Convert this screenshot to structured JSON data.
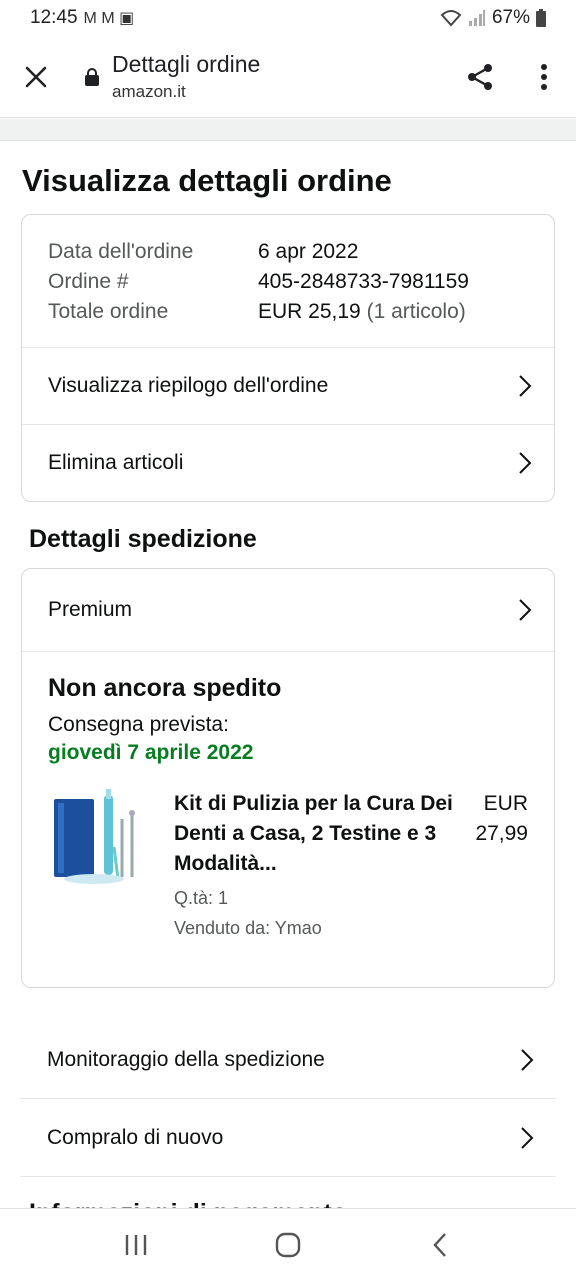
{
  "status_bar": {
    "time": "12:45",
    "notif_icons": "M M ▣",
    "battery": "67%"
  },
  "browser": {
    "title": "Dettagli ordine",
    "domain": "amazon.it"
  },
  "page": {
    "title": "Visualizza dettagli ordine"
  },
  "order": {
    "date_label": "Data dell'ordine",
    "date_value": "6 apr 2022",
    "number_label": "Ordine #",
    "number_value": "405-2848733-7981159",
    "total_label": "Totale ordine",
    "total_value": "EUR 25,19",
    "total_count": "(1 articolo)",
    "summary_link": "Visualizza riepilogo dell'ordine",
    "delete_link": "Elimina articoli"
  },
  "shipping": {
    "section_title": "Dettagli spedizione",
    "method": "Premium",
    "status": "Non ancora spedito",
    "delivery_label": "Consegna prevista:",
    "delivery_date": "giovedì 7 aprile 2022",
    "product": {
      "title": "Kit di Pulizia per la Cura Dei Denti a Casa, 2 Testine e 3 Modalità...",
      "qty": "Q.tà: 1",
      "seller": "Venduto da: Ymao",
      "currency": "EUR",
      "price": "27,99"
    },
    "tracking_link": "Monitoraggio della spedizione",
    "buy_again_link": "Compralo di nuovo"
  },
  "next_section_partial": "Informazioni di pagamento",
  "colors": {
    "delivery_green": "#067d20",
    "text": "#0f1111",
    "muted": "#565959"
  }
}
